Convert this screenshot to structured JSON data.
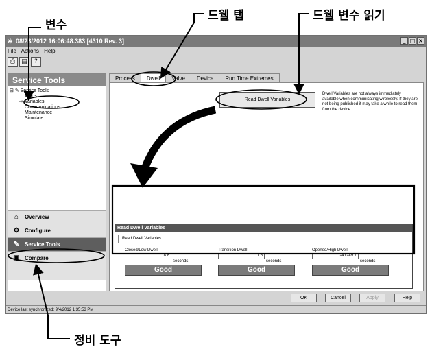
{
  "callouts": {
    "variables": "변수",
    "dwell_tab": "드웰 탭",
    "read_dwell_variables": "드웰 변수 읽기",
    "service_tools": "정비 도구"
  },
  "window": {
    "title": "08/23/2012 16:06:48.383 [4310 Rev. 3]",
    "controls": [
      "_",
      "□",
      "×"
    ]
  },
  "menu": [
    "File",
    "Actions",
    "Help"
  ],
  "toolbar": [
    "print-icon",
    "preview-icon",
    "help-icon"
  ],
  "left_panel": {
    "header": "Service Tools",
    "tree": [
      "Service Tools",
      "Alerts",
      "Variables",
      "Communications",
      "Maintenance",
      "Simulate"
    ],
    "nav": [
      "Overview",
      "Configure",
      "Service Tools",
      "Compare"
    ]
  },
  "tabs": [
    "Process",
    "Dwell",
    "Valve",
    "Device",
    "Run Time Extremes"
  ],
  "content": {
    "read_button": "Read Dwell Variables",
    "note": "Dwell Variables are not always immediately available when communicating wirelessly. If they are not being published it may take a while to read them from the device."
  },
  "panel": {
    "title": "Read Dwell Variables",
    "tab": "Read Dwell Variables",
    "fields": [
      {
        "label": "Closed/Low Dwell",
        "value": "8.8",
        "unit": "seconds",
        "status": "Good"
      },
      {
        "label": "Transition Dwell",
        "value": "1.6",
        "unit": "seconds",
        "status": "Good"
      },
      {
        "label": "Opened/High Dwell",
        "value": "241249.7",
        "unit": "seconds",
        "status": "Good"
      }
    ]
  },
  "buttons": {
    "ok": "OK",
    "cancel": "Cancel",
    "apply": "Apply",
    "help": "Help"
  },
  "status_bar": "Device last synchronized: 9/4/2012 1:35:53 PM"
}
